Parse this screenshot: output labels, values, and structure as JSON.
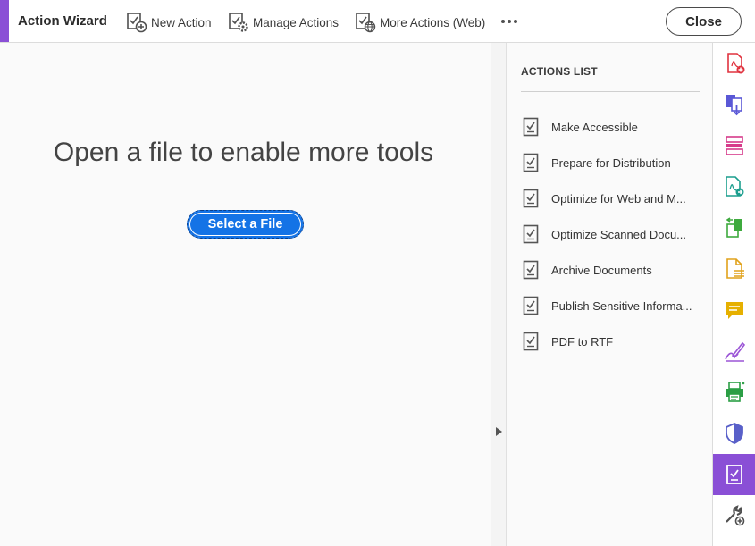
{
  "toolbar": {
    "title": "Action Wizard",
    "new_action": "New Action",
    "manage_actions": "Manage Actions",
    "more_actions_web": "More Actions (Web)",
    "close": "Close"
  },
  "main": {
    "heading": "Open a file to enable more tools",
    "select_file": "Select a File"
  },
  "actions_panel": {
    "title": "ACTIONS LIST",
    "items": [
      {
        "label": "Make Accessible"
      },
      {
        "label": "Prepare for Distribution"
      },
      {
        "label": "Optimize for Web and M..."
      },
      {
        "label": "Optimize Scanned Docu..."
      },
      {
        "label": "Archive Documents"
      },
      {
        "label": "Publish Sensitive Informa..."
      },
      {
        "label": "PDF to RTF"
      }
    ]
  },
  "tool_rail": {
    "icons": [
      {
        "name": "create-pdf-icon",
        "color": "#e0333f"
      },
      {
        "name": "combine-files-icon",
        "color": "#5a58d6"
      },
      {
        "name": "organize-pages-icon",
        "color": "#d63a8a"
      },
      {
        "name": "export-pdf-icon",
        "color": "#1b9e8e"
      },
      {
        "name": "edit-pdf-icon",
        "color": "#3eaa3e"
      },
      {
        "name": "scan-ocr-icon",
        "color": "#e1a21b"
      },
      {
        "name": "comment-icon",
        "color": "#e6b000"
      },
      {
        "name": "fill-sign-icon",
        "color": "#9b55d6"
      },
      {
        "name": "print-production-icon",
        "color": "#2b9e45"
      },
      {
        "name": "protect-icon",
        "color": "#5960c9"
      },
      {
        "name": "action-wizard-icon",
        "color": "#ffffff"
      },
      {
        "name": "more-tools-icon",
        "color": "#505050"
      }
    ]
  },
  "colors": {
    "accent": "#8a4fd6",
    "primary_button": "#1473e6"
  }
}
